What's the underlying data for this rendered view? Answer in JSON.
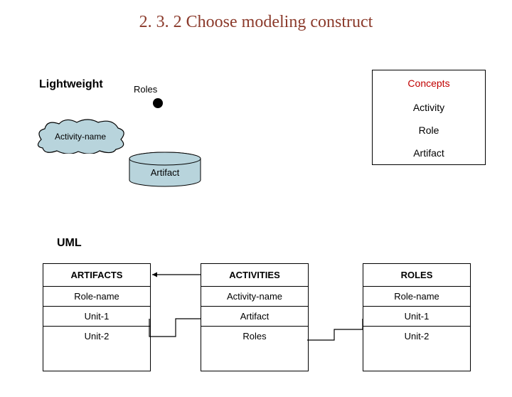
{
  "title": "2. 3. 2  Choose modeling construct",
  "lightweight": {
    "label": "Lightweight",
    "roles_label": "Roles",
    "cloud_label": "Activity-name",
    "cylinder_label": "Artifact"
  },
  "concepts": {
    "header": "Concepts",
    "rows": [
      "Activity",
      "Role",
      "Artifact"
    ]
  },
  "uml": {
    "label": "UML",
    "tables": {
      "artifacts": {
        "header": "ARTIFACTS",
        "rows": [
          "Role-name",
          "Unit-1",
          "Unit-2"
        ]
      },
      "activities": {
        "header": "ACTIVITIES",
        "rows": [
          "Activity-name",
          "Artifact",
          "Roles"
        ]
      },
      "roles": {
        "header": "ROLES",
        "rows": [
          "Role-name",
          "Unit-1",
          "Unit-2"
        ]
      }
    }
  },
  "chart_data": {
    "type": "diagram",
    "title": "2.3.2 Choose modeling construct",
    "sections": {
      "Lightweight": {
        "nodes": [
          "Roles (dot)",
          "Activity-name (cloud)",
          "Artifact (cylinder)"
        ]
      },
      "Concepts": [
        "Activity",
        "Role",
        "Artifact"
      ],
      "UML": {
        "ARTIFACTS": [
          "Role-name",
          "Unit-1",
          "Unit-2"
        ],
        "ACTIVITIES": [
          "Activity-name",
          "Artifact",
          "Roles"
        ],
        "ROLES": [
          "Role-name",
          "Unit-1",
          "Unit-2"
        ]
      }
    },
    "connectors": [
      {
        "from": "ACTIVITIES header",
        "to": "ARTIFACTS header",
        "style": "arrow"
      },
      {
        "from": "ACTIVITIES.Artifact",
        "to": "ARTIFACTS.Unit-1",
        "style": "line"
      },
      {
        "from": "ACTIVITIES.Roles",
        "to": "ROLES.Unit-1",
        "style": "line"
      }
    ]
  }
}
